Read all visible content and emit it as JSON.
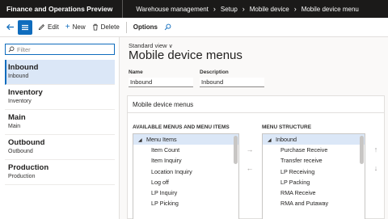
{
  "app": {
    "title": "Finance and Operations Preview",
    "breadcrumbs": [
      "Warehouse management",
      "Setup",
      "Mobile device",
      "Mobile device menu"
    ]
  },
  "toolbar": {
    "edit": "Edit",
    "new": "New",
    "delete": "Delete",
    "options": "Options"
  },
  "list": {
    "filter_placeholder": "Filter",
    "items": [
      {
        "title": "Inbound",
        "sub": "Inbound",
        "selected": true
      },
      {
        "title": "Inventory",
        "sub": "Inventory"
      },
      {
        "title": "Main",
        "sub": "Main"
      },
      {
        "title": "Outbound",
        "sub": "Outbound"
      },
      {
        "title": "Production",
        "sub": "Production"
      }
    ]
  },
  "main": {
    "view": "Standard view",
    "title": "Mobile device menus",
    "name_label": "Name",
    "name_value": "Inbound",
    "desc_label": "Description",
    "desc_value": "Inbound",
    "section_title": "Mobile device menus",
    "available_label": "AVAILABLE MENUS AND MENU ITEMS",
    "structure_label": "MENU STRUCTURE",
    "available": {
      "root": "Menu Items",
      "items": [
        "Item Count",
        "Item Inquiry",
        "Location Inquiry",
        "Log off",
        "LP Inquiry",
        "LP Picking"
      ]
    },
    "structure": {
      "root": "Inbound",
      "items": [
        "Purchase Receive",
        "Transfer receive",
        "LP Receiving",
        "LP Packing",
        "RMA Receive",
        "RMA and Putaway"
      ]
    }
  },
  "colors": {
    "accent": "#0f6cbd",
    "topbar": "#1b1a19",
    "selected": "#dbe7f7"
  }
}
